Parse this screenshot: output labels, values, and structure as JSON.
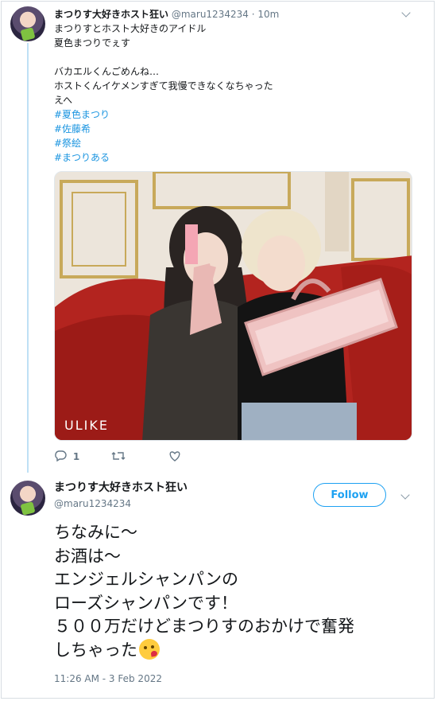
{
  "tweet1": {
    "display_name": "まつりす大好きホスト狂い",
    "handle": "@maru1234234",
    "separator": "·",
    "time": "10m",
    "lines": [
      "まつりすとホスト大好きのアイドル",
      "夏色まつりでぇす",
      "",
      "バカエルくんごめんね…",
      "ホストくんイケメンすぎて我慢できなくなちゃった",
      "えへ"
    ],
    "hashtags": [
      "#夏色まつり",
      "#佐藤希",
      "#祭絵",
      "#まつりある"
    ],
    "photo_watermark": "ULIKE",
    "reply_count": "1",
    "colors": {
      "hashtag": "#1b95e0",
      "thread_line": "#bfe0f5"
    }
  },
  "tweet2": {
    "display_name": "まつりす大好きホスト狂い",
    "handle": "@maru1234234",
    "follow_label": "Follow",
    "lines": [
      "ちなみに〜",
      "お酒は〜",
      "エンジェルシャンパンの",
      "ローズシャンパンです！",
      "５００万だけどまつりすのおかけで奮発",
      "しちゃった"
    ],
    "emoji": "face-blowing-kiss",
    "timestamp": "11:26 AM - 3 Feb 2022",
    "colors": {
      "follow": "#1da1f2"
    }
  }
}
